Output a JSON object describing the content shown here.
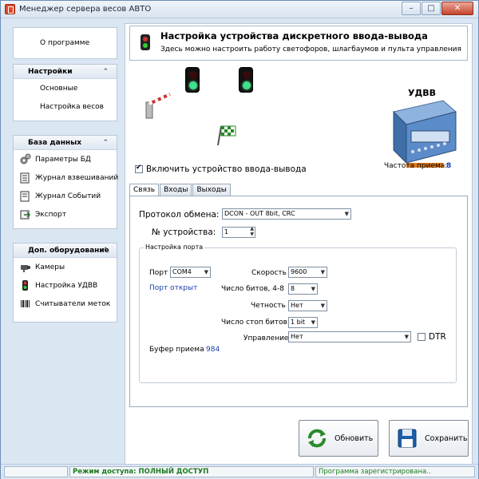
{
  "window": {
    "title": "Менеджер сервера весов АВТО"
  },
  "sidebar": {
    "about": "О программе",
    "settings_title": "Настройки",
    "settings_items": [
      "Основные",
      "Настройка весов"
    ],
    "db_title": "База данных",
    "db_items": [
      "Параметры БД",
      "Журнал взвешиваний",
      "Журнал Событий",
      "Экспорт"
    ],
    "equip_title": "Доп. оборудование",
    "equip_items": [
      "Камеры",
      "Настройка УДВВ",
      "Считыватели меток"
    ]
  },
  "header": {
    "title": "Настройка устройства дискретного ввода-вывода",
    "subtitle": "Здесь можно настроить работу светофоров, шлагбаумов и пульта управления"
  },
  "device": {
    "label": "УДВВ",
    "freq_label": "Частота приема:",
    "freq_value": "8"
  },
  "enable": {
    "label": "Включить устройство ввода-вывода",
    "checked": true
  },
  "tabs": [
    "Связь",
    "Входы",
    "Выходы"
  ],
  "connection": {
    "protocol_label": "Протокол обмена:",
    "protocol_value": "DCON - OUT 8bit, CRC",
    "device_no_label": "№ устройства:",
    "device_no_value": "1"
  },
  "port": {
    "group_title": "Настройка порта",
    "port_label": "Порт",
    "port_value": "COM4",
    "port_status": "Порт открыт",
    "speed_label": "Скорость",
    "speed_value": "9600",
    "bits_label": "Число битов, 4-8",
    "bits_value": "8",
    "parity_label": "Четность",
    "parity_value": "Нет",
    "stopbits_label": "Число стоп битов",
    "stopbits_value": "1 bit",
    "control_label": "Управление",
    "control_value": "Нет",
    "dtr_label": "DTR",
    "buffer_label": "Буфер приема",
    "buffer_value": "984"
  },
  "buttons": {
    "refresh": "Обновить",
    "save": "Сохранить"
  },
  "status": {
    "access": "Режим доступа: ПОЛНЫЙ ДОСТУП",
    "registration": "Программа зарегистрирована.."
  },
  "colors": {
    "accent": "#1a3fa8",
    "status_green": "#1d7a1d",
    "frame": "#dbe6f3"
  }
}
